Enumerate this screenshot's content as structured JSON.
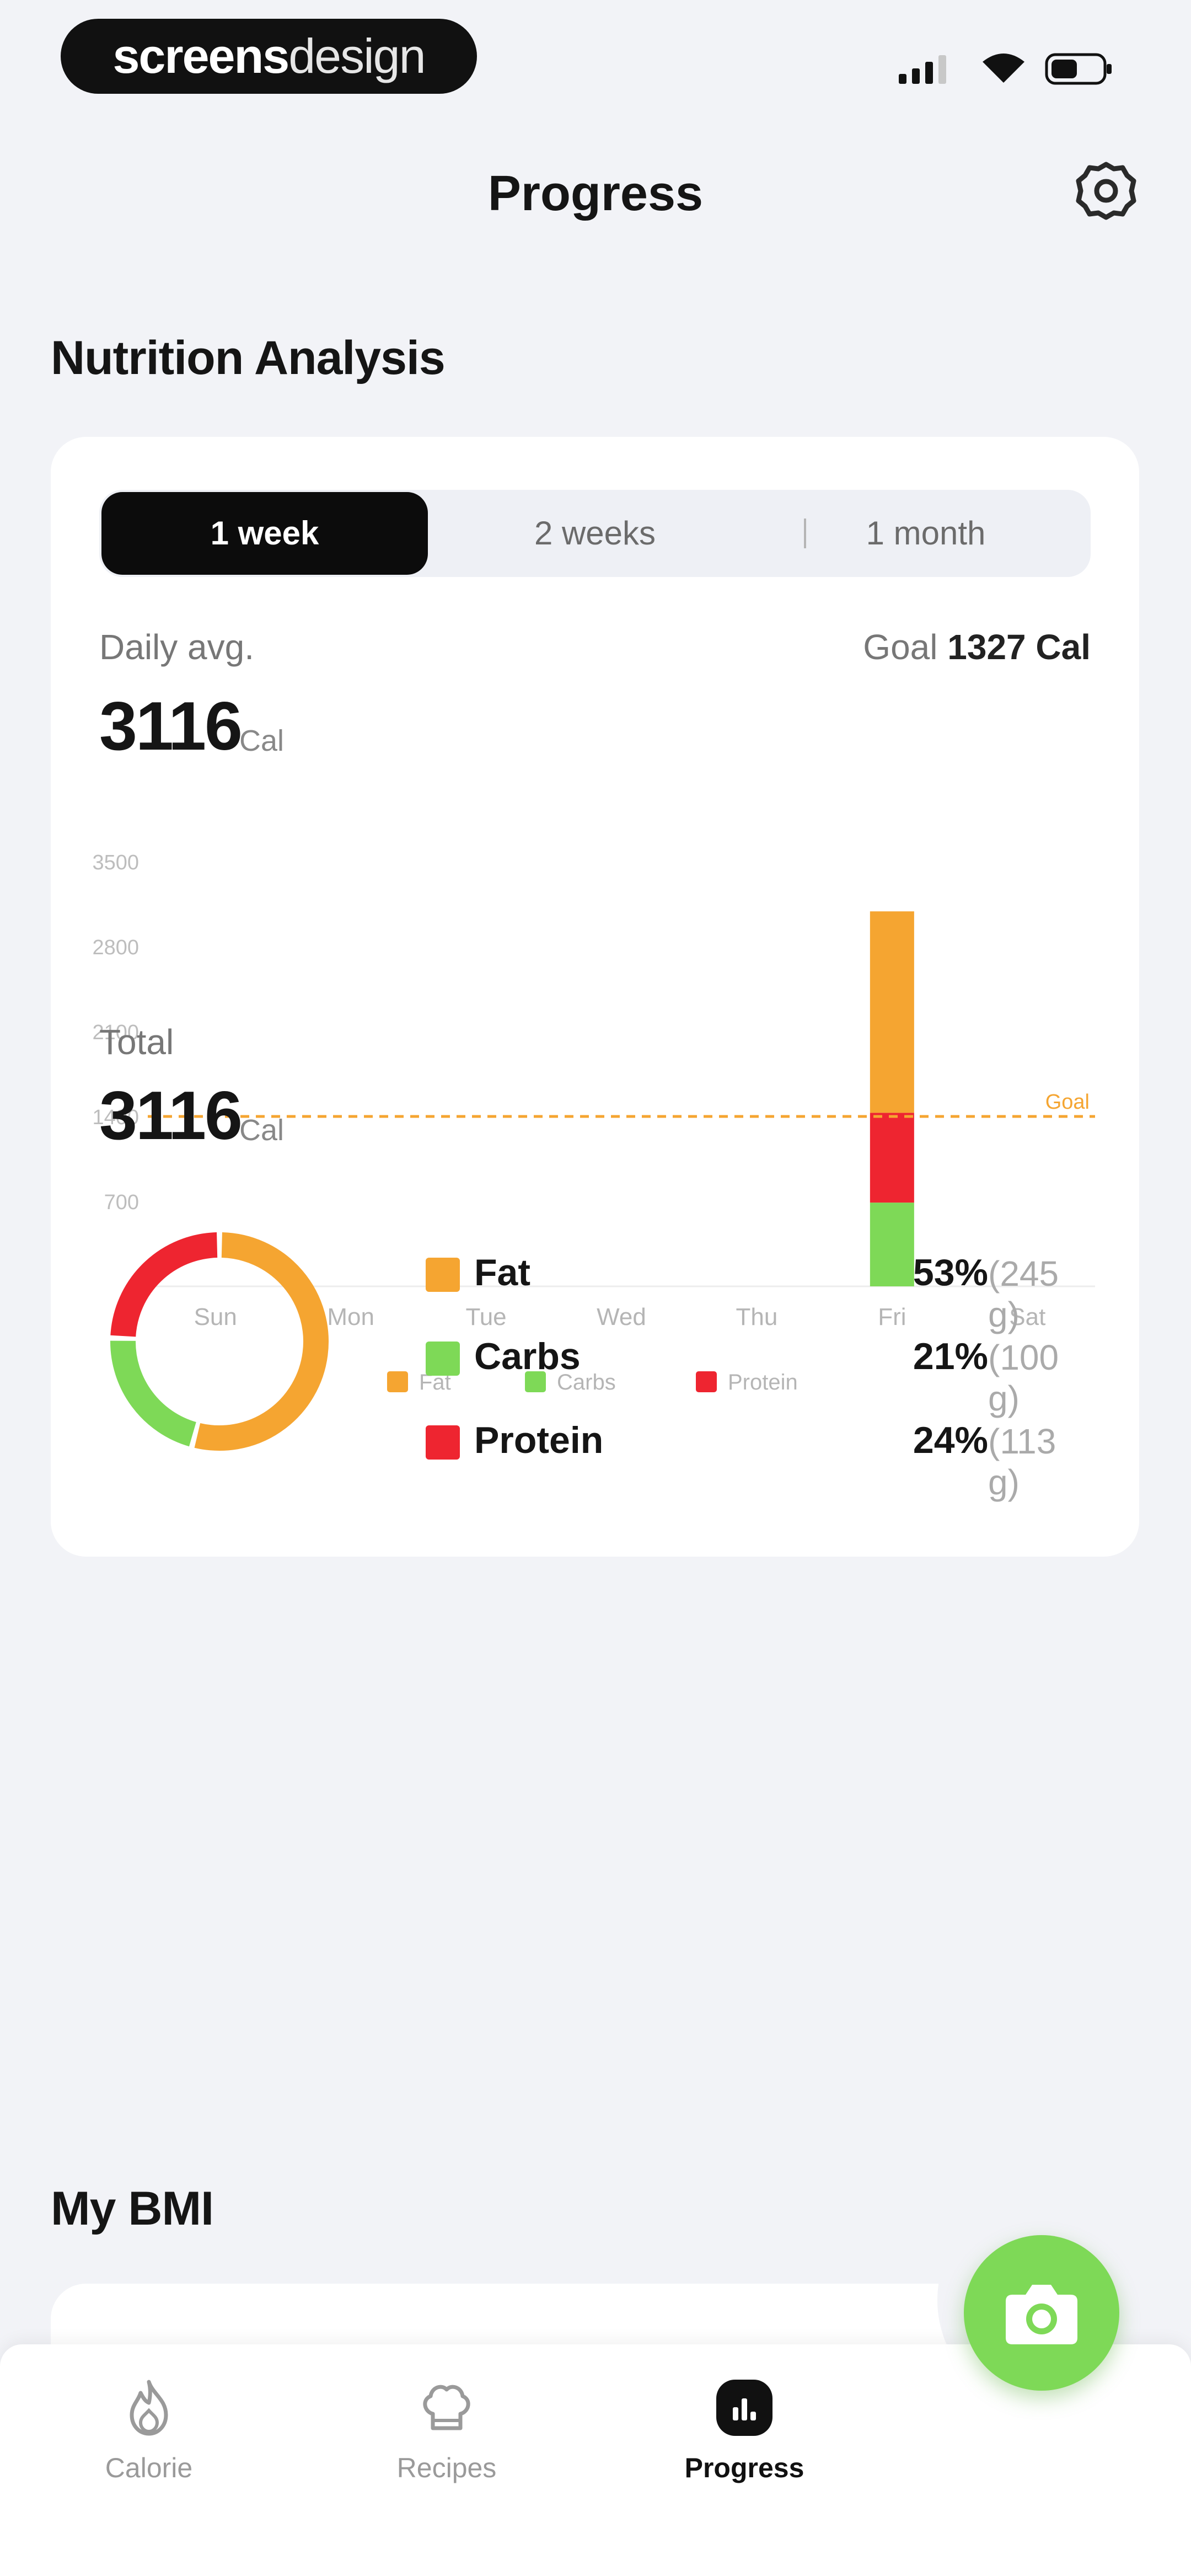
{
  "status_bar": {
    "brand_bold": "screens",
    "brand_light": "design"
  },
  "header": {
    "title": "Progress"
  },
  "nutrition": {
    "section_title": "Nutrition Analysis",
    "tabs": [
      {
        "label": "1 week",
        "active": true
      },
      {
        "label": "2 weeks",
        "active": false
      },
      {
        "label": "1 month",
        "active": false
      }
    ],
    "daily_avg_label": "Daily avg.",
    "goal_label": "Goal",
    "goal_value": "1327 Cal",
    "daily_avg_value": "3116",
    "unit": "Cal",
    "total_label": "Total",
    "total_value": "3116"
  },
  "chart_data": {
    "type": "bar",
    "stacked": true,
    "categories": [
      "Sun",
      "Mon",
      "Tue",
      "Wed",
      "Thu",
      "Fri",
      "Sat"
    ],
    "yticks": [
      "0",
      "700",
      "1400",
      "2100",
      "2800",
      "3500"
    ],
    "ylim": [
      0,
      3500
    ],
    "goal_line": {
      "value": 1400,
      "label": "Goal"
    },
    "series": [
      {
        "name": "Carbs",
        "color": "#7ed957",
        "values": [
          0,
          0,
          0,
          0,
          0,
          690,
          0
        ]
      },
      {
        "name": "Protein",
        "color": "#ee2530",
        "values": [
          0,
          0,
          0,
          0,
          0,
          740,
          0
        ]
      },
      {
        "name": "Fat",
        "color": "#f5a531",
        "values": [
          0,
          0,
          0,
          0,
          0,
          1660,
          0
        ]
      }
    ],
    "legend_order": [
      "Fat",
      "Carbs",
      "Protein"
    ],
    "legend_position": "bottom"
  },
  "macros": [
    {
      "name": "Fat",
      "color": "#f5a531",
      "percent": "53%",
      "grams": "(245 g)",
      "fraction": 0.53
    },
    {
      "name": "Carbs",
      "color": "#7ed957",
      "percent": "21%",
      "grams": "(100 g)",
      "fraction": 0.21
    },
    {
      "name": "Protein",
      "color": "#ee2530",
      "percent": "24%",
      "grams": "(113 g)",
      "fraction": 0.24
    }
  ],
  "bmi": {
    "section_title": "My BMI"
  },
  "bottom_nav": [
    {
      "label": "Calorie",
      "icon": "flame-icon",
      "active": false
    },
    {
      "label": "Recipes",
      "icon": "chef-hat-icon",
      "active": false
    },
    {
      "label": "Progress",
      "icon": "progress-chart-icon",
      "active": true
    }
  ],
  "camera_button": {
    "icon": "camera-icon",
    "color": "#7ed957"
  }
}
